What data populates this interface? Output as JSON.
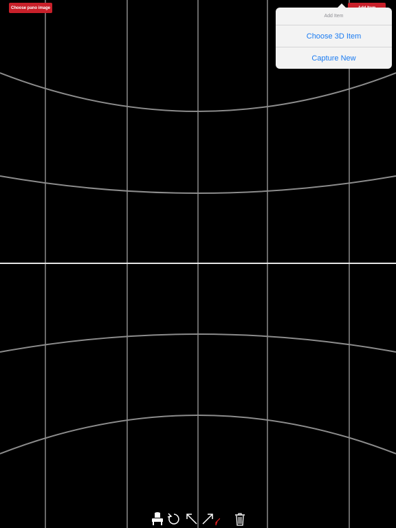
{
  "top_bar": {
    "pano_button_label": "Choose pano image",
    "add_button_label": "Add Item"
  },
  "popover": {
    "title": "Add Item",
    "items": [
      {
        "label": "Choose 3D Item"
      },
      {
        "label": "Capture New"
      }
    ]
  },
  "toolbar": {
    "tools": [
      {
        "icon": "chair-icon"
      },
      {
        "icon": "rotate-icon"
      },
      {
        "icon": "arrow-up-left-icon"
      },
      {
        "icon": "arrow-up-right-pencil-icon"
      },
      {
        "icon": "trash-icon"
      }
    ]
  },
  "colors": {
    "background": "#000000",
    "grid_line": "#8c8c8c",
    "horizon": "#e6e6e6",
    "button_red": "#c8202a",
    "link_blue": "#1a7bf2",
    "popover_bg": "#f3f3f3"
  }
}
